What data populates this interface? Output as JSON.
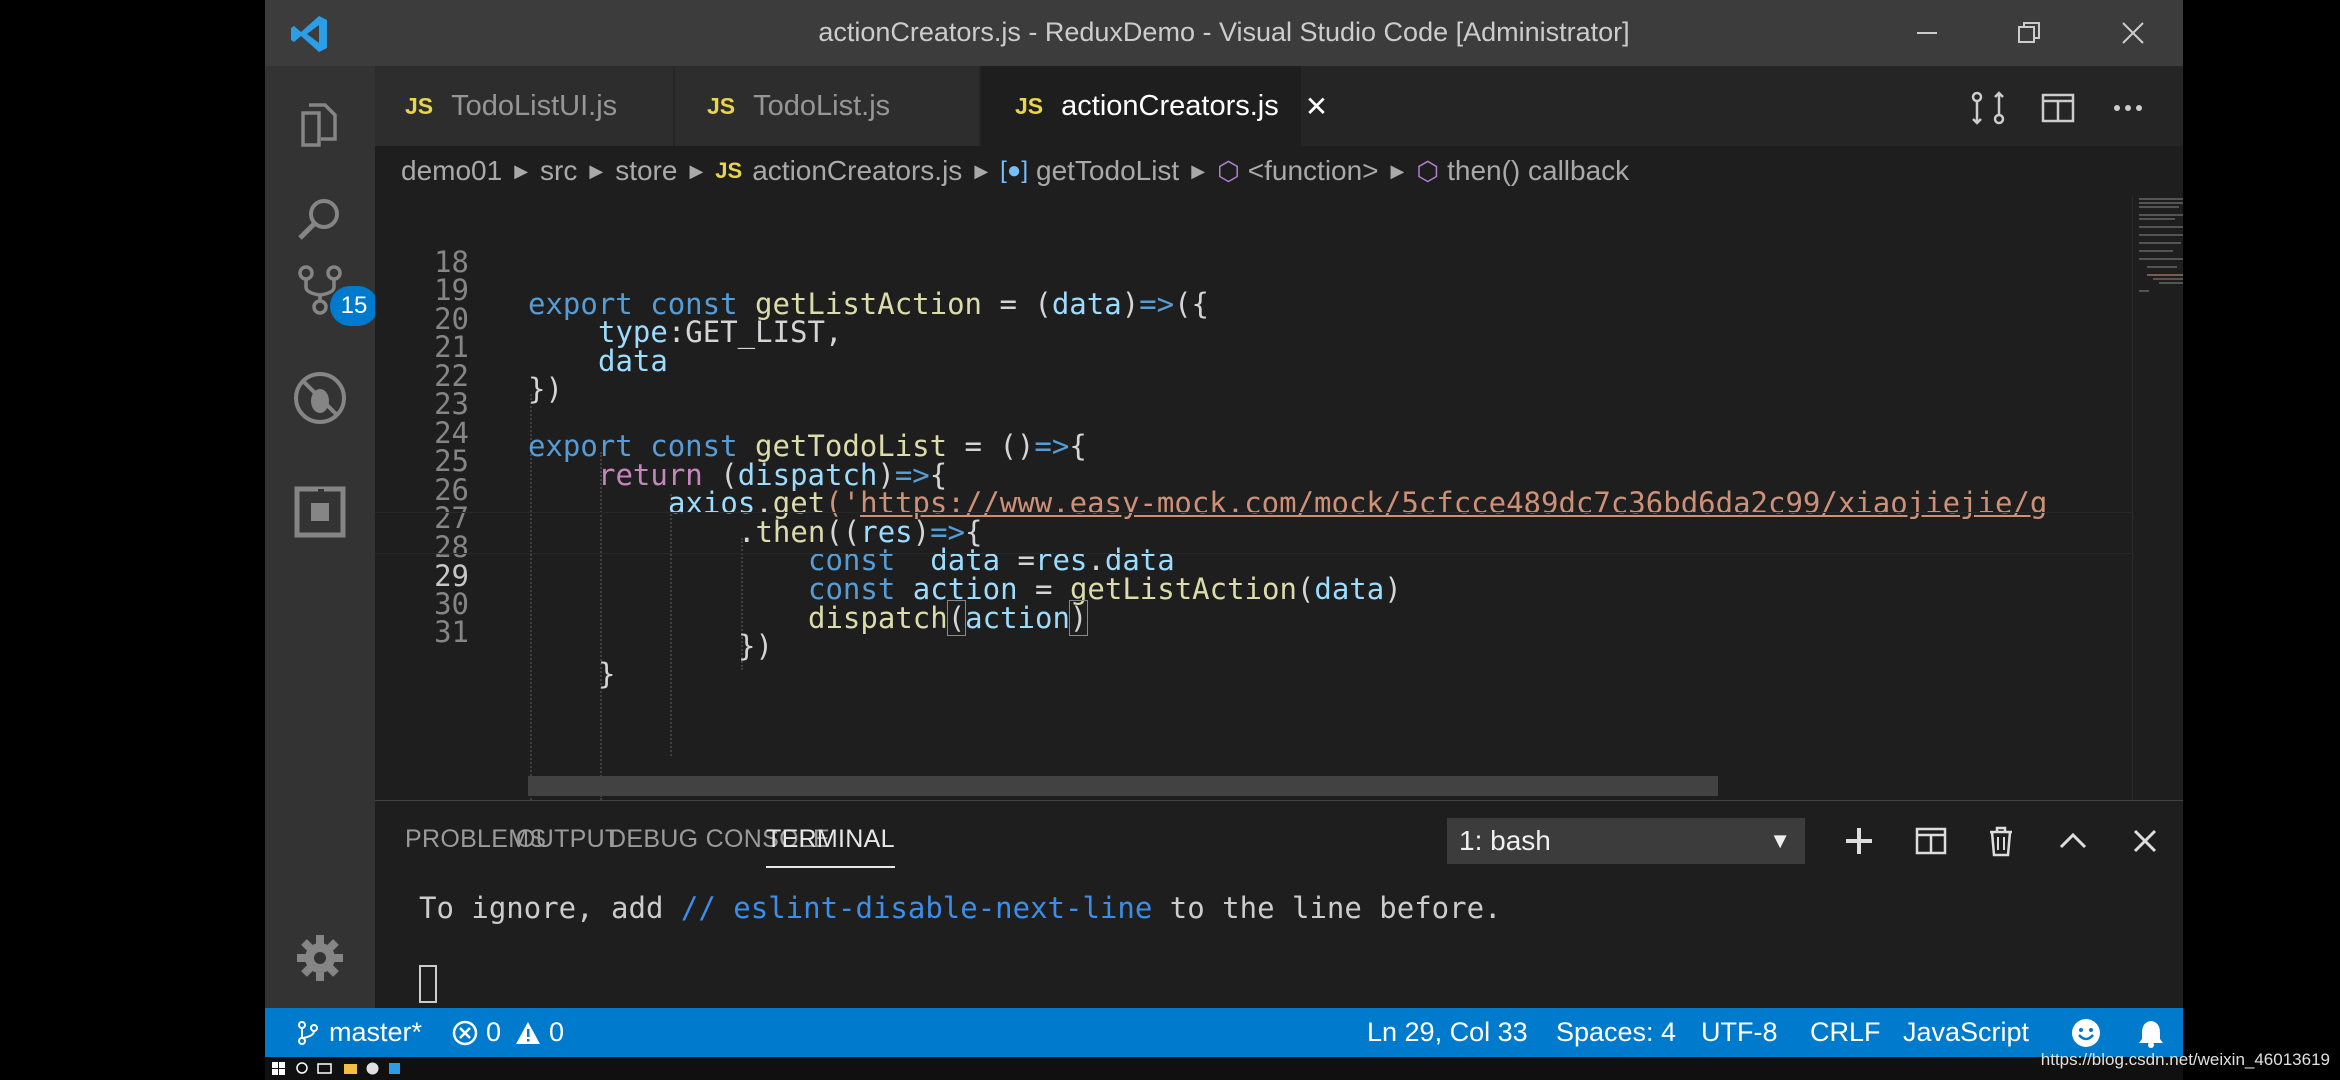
{
  "window": {
    "title": "actionCreators.js - ReduxDemo - Visual Studio Code [Administrator]"
  },
  "activity_bar": {
    "scm_badge": "15"
  },
  "tabs": [
    {
      "icon": "JS",
      "label": "TodoListUI.js",
      "active": false
    },
    {
      "icon": "JS",
      "label": "TodoList.js",
      "active": false
    },
    {
      "icon": "JS",
      "label": "actionCreators.js",
      "active": true,
      "close": "✕"
    }
  ],
  "breadcrumbs": [
    "demo01",
    "src",
    "store",
    "actionCreators.js",
    "getTodoList",
    "<function>",
    "then() callback"
  ],
  "editor": {
    "current_line": 29,
    "lines": [
      {
        "n": "18"
      },
      {
        "n": "19"
      },
      {
        "n": "20"
      },
      {
        "n": "21"
      },
      {
        "n": "22"
      },
      {
        "n": "23"
      },
      {
        "n": "24"
      },
      {
        "n": "25"
      },
      {
        "n": "26"
      },
      {
        "n": "27"
      },
      {
        "n": "28"
      },
      {
        "n": "29"
      },
      {
        "n": "30"
      },
      {
        "n": "31"
      }
    ],
    "code": {
      "l18_kw1": "export",
      "l18_kw2": "const",
      "l18_fn": "getListAction",
      "l18_p1": " = (",
      "l18_var": "data",
      "l18_p2": ")",
      "l18_arrow": "=>",
      "l18_p3": "({",
      "l19_var": "type",
      "l19_p": ":GET_LIST,",
      "l20_var": "data",
      "l21_p": "})",
      "l23_kw1": "export",
      "l23_kw2": "const",
      "l23_fn": "getTodoList",
      "l23_p1": " = ()",
      "l23_arrow": "=>",
      "l23_p2": "{",
      "l24_kw": "return",
      "l24_p1": " (",
      "l24_var": "dispatch",
      "l24_p2": ")",
      "l24_arrow": "=>",
      "l24_p3": "{",
      "l25_var": "axios",
      "l25_p1": ".",
      "l25_fn": "get",
      "l25_p2": "('",
      "l25_str": "https://www.easy-mock.com/mock/5cfcce489dc7c36bd6da2c99/xiaojiejie/g",
      "l26_p1": ".",
      "l26_fn": "then",
      "l26_p2": "((",
      "l26_var": "res",
      "l26_p3": ")",
      "l26_arrow": "=>",
      "l26_p4": "{",
      "l27_kw": "const",
      "l27_var1": "data",
      "l27_p1": " =",
      "l27_var2": "res",
      "l27_p2": ".",
      "l27_var3": "data",
      "l28_kw": "const",
      "l28_var1": "action",
      "l28_p1": " = ",
      "l28_fn": "getListAction",
      "l28_p2": "(",
      "l28_var2": "data",
      "l28_p3": ")",
      "l29_fn": "dispatch",
      "l29_p1": "(",
      "l29_var": "action",
      "l29_p2": ")",
      "l30_p": "})",
      "l31_p": "}"
    }
  },
  "panel": {
    "tabs": [
      "PROBLEMS",
      "OUTPUT",
      "DEBUG CONSOLE",
      "TERMINAL"
    ],
    "active_tab": "TERMINAL",
    "terminal_select": "1: bash",
    "terminal_line_pre": "To ignore, add ",
    "terminal_line_comment": "// eslint-disable-next-line",
    "terminal_line_post": " to the line before."
  },
  "status_bar": {
    "branch": "master*",
    "errors": "0",
    "warnings": "0",
    "position": "Ln 29, Col 33",
    "spaces": "Spaces: 4",
    "encoding": "UTF-8",
    "eol": "CRLF",
    "language": "JavaScript"
  },
  "watermark": "https://blog.csdn.net/weixin_46013619",
  "colors": {
    "accent": "#007acc",
    "keyword": "#569cd6",
    "function": "#dcdcaa",
    "variable": "#9cdcfe",
    "string": "#ce9178"
  }
}
